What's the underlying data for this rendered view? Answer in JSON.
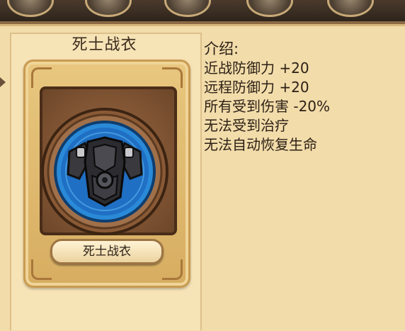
{
  "item": {
    "title": "死士战衣",
    "card_name": "死士战衣"
  },
  "description": {
    "heading": "介绍:",
    "lines": [
      "近战防御力 +20",
      "远程防御力 +20",
      "所有受到伤害 -20%",
      "无法受到治疗",
      "无法自动恢复生命"
    ]
  },
  "icons": {
    "armor": "chest-armor-icon",
    "top_ornaments": "medallion-icon"
  },
  "colors": {
    "parchment": "#f2dcaa",
    "card_frame": "#d7ad61",
    "shield_blue": "#1f6fc4",
    "text": "#2b1f15"
  }
}
